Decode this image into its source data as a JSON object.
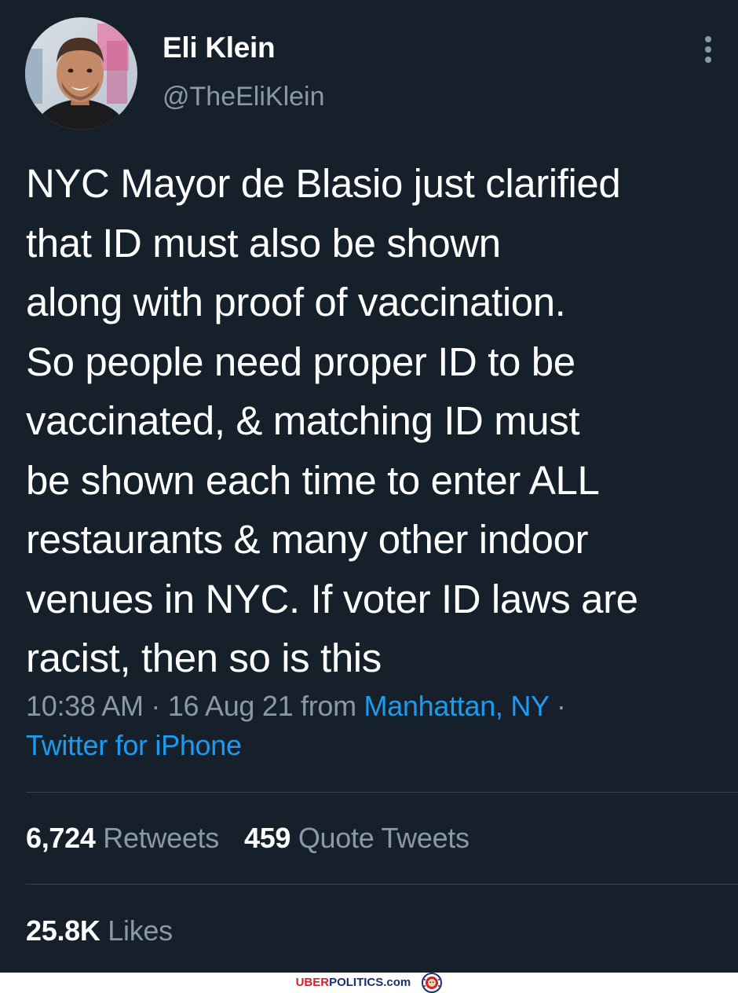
{
  "tweet": {
    "author": {
      "display_name": "Eli Klein",
      "handle": "@TheEliKlein",
      "avatar": "profile-photo"
    },
    "text_lines": [
      "NYC Mayor de Blasio just clarified",
      "that ID must also be shown",
      "along with proof of vaccination.",
      "So people need proper ID to be",
      "vaccinated, & matching ID must",
      "be shown each time to enter ALL",
      "restaurants & many other indoor",
      "venues in NYC. If voter ID laws are",
      "racist, then so is this"
    ],
    "time": "10:38 AM",
    "date": "16 Aug 21",
    "from_label": "from",
    "location": "Manhattan, NY",
    "source": "Twitter for iPhone",
    "separator": "·",
    "more_icon": "more-vertical-icon"
  },
  "stats": {
    "retweets": {
      "count": "6,724",
      "label": "Retweets"
    },
    "quote_tweets": {
      "count": "459",
      "label": "Quote Tweets"
    },
    "likes": {
      "count": "25.8K",
      "label": "Likes"
    }
  },
  "watermark": {
    "brand_part1": "UBER",
    "brand_part2": "POLITICS.com",
    "logo": "lion-crest-icon"
  },
  "colors": {
    "background": "#15202b",
    "text": "#ffffff",
    "secondary_text": "#8b98a5",
    "link": "#1d9bf0",
    "divider": "#38444d"
  }
}
